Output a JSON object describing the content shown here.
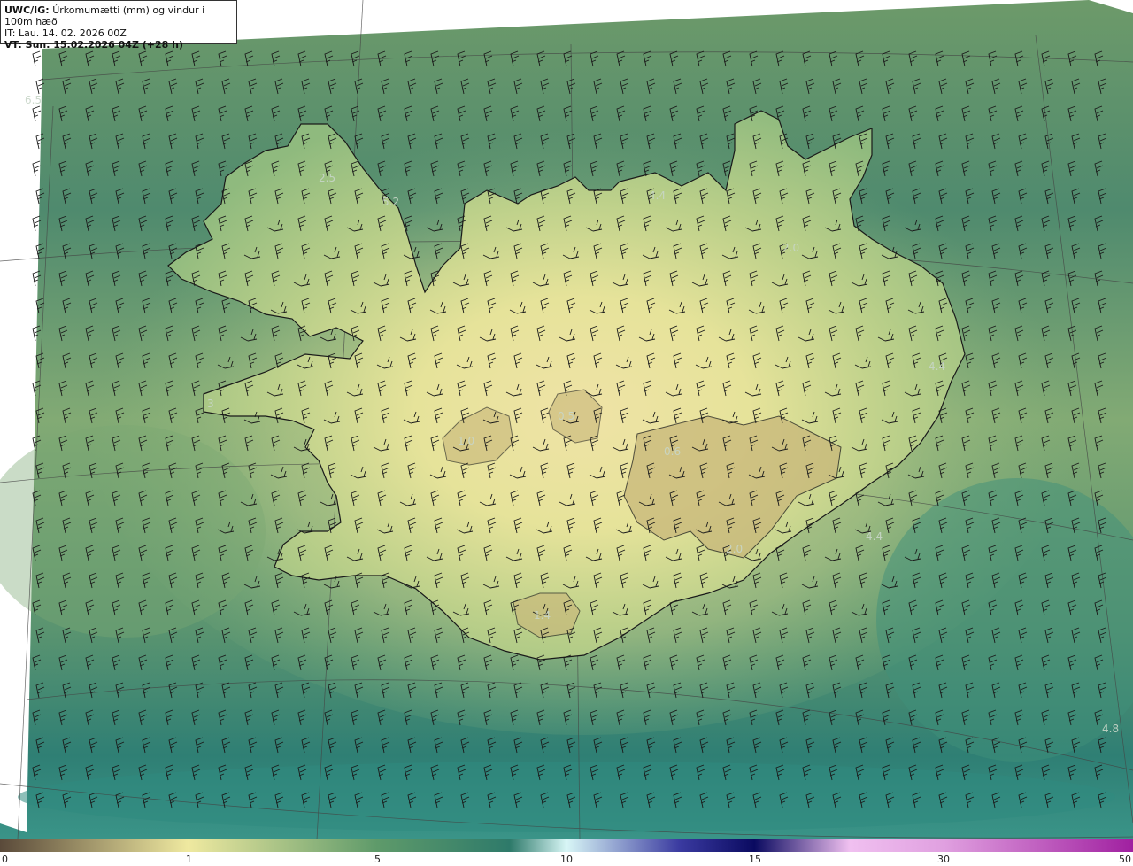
{
  "header": {
    "model": "UWC/IG:",
    "title": "Úrkomumætti (mm) og vindur i 100m hæð",
    "it": "IT: Lau. 14. 02. 2026 00Z",
    "vt": "VT: Sun. 15.02.2026 04Z (+28 h)"
  },
  "labels": [
    {
      "text": "6.5",
      "id": "label-w"
    },
    {
      "text": "2.5",
      "id": "label-westfjords"
    },
    {
      "text": "5.2",
      "id": "label-nw"
    },
    {
      "text": "4.4",
      "id": "label-n"
    },
    {
      "text": "2.0",
      "id": "label-ne"
    },
    {
      "text": "4.4",
      "id": "label-e"
    },
    {
      "text": "0.6",
      "id": "label-central"
    },
    {
      "text": "2.0",
      "id": "label-se"
    },
    {
      "text": "4.4",
      "id": "label-se-sea"
    },
    {
      "text": "4.8",
      "id": "label-s-sea"
    },
    {
      "text": "3",
      "id": "label-snaefells"
    },
    {
      "text": "1.0",
      "id": "label-langjokull"
    },
    {
      "text": "0.5",
      "id": "label-hofsjokull"
    },
    {
      "text": "1.4",
      "id": "label-myrdals"
    }
  ],
  "colorbar": {
    "ticks": [
      "0",
      "1",
      "5",
      "10",
      "15",
      "30",
      "50"
    ],
    "colors": [
      "#5a4a3a",
      "#a08e6a",
      "#efe9a0",
      "#b5cc85",
      "#5e9a6a",
      "#2e7a6a",
      "#9fe0d8",
      "#d8f6f6",
      "#3a3aa0",
      "#0a0a60",
      "#e0a0e0",
      "#c050c0",
      "#a020a0"
    ]
  }
}
